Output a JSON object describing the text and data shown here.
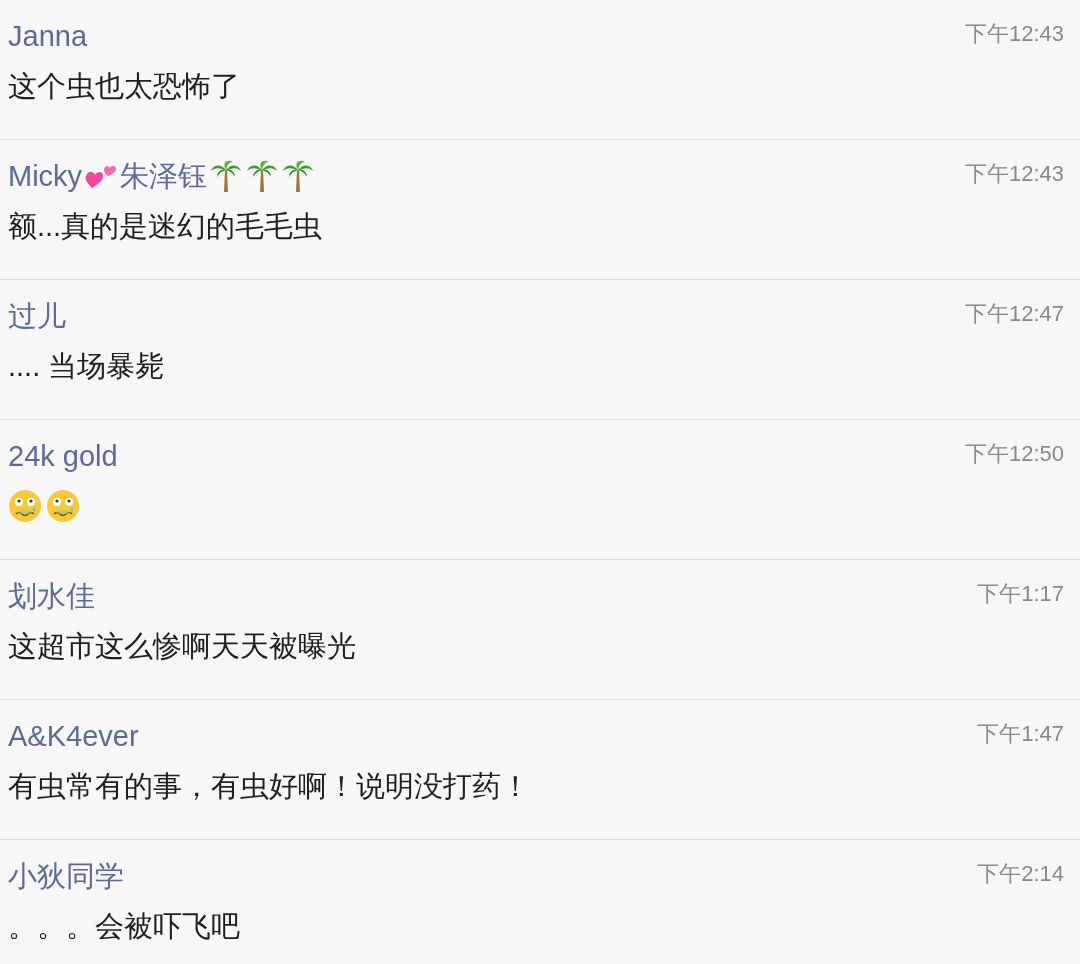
{
  "comments": [
    {
      "author": [
        {
          "kind": "text",
          "text": "Janna"
        }
      ],
      "time": "下午12:43",
      "body": [
        {
          "kind": "text",
          "text": "这个虫也太恐怖了"
        }
      ]
    },
    {
      "author": [
        {
          "kind": "text",
          "text": "Micky"
        },
        {
          "kind": "hearts"
        },
        {
          "kind": "text",
          "text": "朱泽钰"
        },
        {
          "kind": "palm"
        },
        {
          "kind": "palm"
        },
        {
          "kind": "palm"
        }
      ],
      "time": "下午12:43",
      "body": [
        {
          "kind": "text",
          "text": "额...真的是迷幻的毛毛虫"
        }
      ]
    },
    {
      "author": [
        {
          "kind": "text",
          "text": "过儿"
        }
      ],
      "time": "下午12:47",
      "body": [
        {
          "kind": "text",
          "text": ".... 当场暴毙"
        }
      ]
    },
    {
      "author": [
        {
          "kind": "text",
          "text": "24k gold"
        }
      ],
      "time": "下午12:50",
      "body": [
        {
          "kind": "woozy"
        },
        {
          "kind": "woozy"
        }
      ]
    },
    {
      "author": [
        {
          "kind": "text",
          "text": "划水佳"
        }
      ],
      "time": "下午1:17",
      "body": [
        {
          "kind": "text",
          "text": "这超市这么惨啊天天被曝光"
        }
      ]
    },
    {
      "author": [
        {
          "kind": "text",
          "text": "A&K4ever"
        }
      ],
      "time": "下午1:47",
      "body": [
        {
          "kind": "text",
          "text": "有虫常有的事，有虫好啊！说明没打药！"
        }
      ]
    },
    {
      "author": [
        {
          "kind": "text",
          "text": "小狄同学"
        }
      ],
      "time": "下午2:14",
      "body": [
        {
          "kind": "text",
          "text": "。。。会被吓飞吧"
        }
      ]
    }
  ]
}
